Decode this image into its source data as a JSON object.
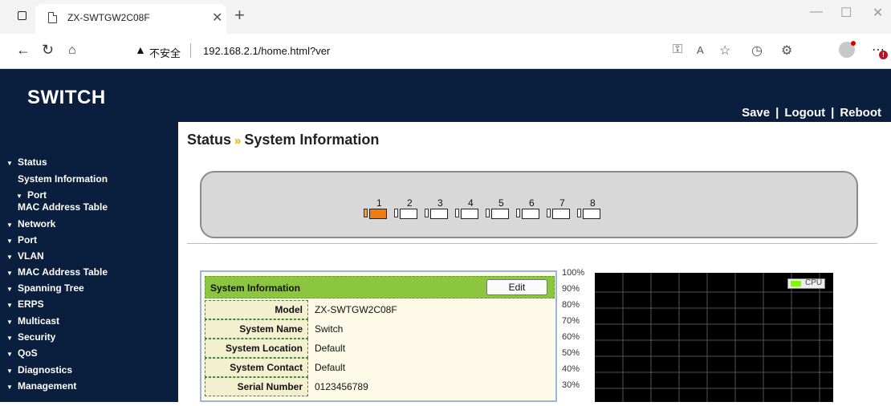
{
  "browser": {
    "tab_title": "ZX-SWTGW2C08F",
    "security_label": "不安全",
    "url": "192.168.2.1/home.html?ver",
    "more_badge": "!"
  },
  "header": {
    "logo": "SWITCH",
    "links": [
      "Save",
      "Logout",
      "Reboot"
    ]
  },
  "sidebar": {
    "items": [
      {
        "label": "Status",
        "expanded": true
      },
      {
        "label": "System Information",
        "sub": true
      },
      {
        "label": "Port",
        "sub": true,
        "expandable": true
      },
      {
        "label": "MAC Address Table",
        "sub": true
      },
      {
        "label": "Network"
      },
      {
        "label": "Port"
      },
      {
        "label": "VLAN"
      },
      {
        "label": "MAC Address Table"
      },
      {
        "label": "Spanning Tree"
      },
      {
        "label": "ERPS"
      },
      {
        "label": "Multicast"
      },
      {
        "label": "Security"
      },
      {
        "label": "QoS"
      },
      {
        "label": "Diagnostics"
      },
      {
        "label": "Management"
      }
    ]
  },
  "breadcrumb": {
    "parent": "Status",
    "separator": "»",
    "current": "System Information"
  },
  "ports": [
    {
      "num": "1",
      "active": true
    },
    {
      "num": "2",
      "active": false
    },
    {
      "num": "3",
      "active": false
    },
    {
      "num": "4",
      "active": false
    },
    {
      "num": "5",
      "active": false
    },
    {
      "num": "6",
      "active": false
    },
    {
      "num": "7",
      "active": false
    },
    {
      "num": "8",
      "active": false
    }
  ],
  "system_info": {
    "title": "System Information",
    "edit_label": "Edit",
    "rows": [
      {
        "label": "Model",
        "value": "ZX-SWTGW2C08F"
      },
      {
        "label": "System Name",
        "value": "Switch"
      },
      {
        "label": "System Location",
        "value": "Default"
      },
      {
        "label": "System Contact",
        "value": "Default"
      },
      {
        "label": "Serial Number",
        "value": "0123456789"
      }
    ]
  },
  "cpu_chart": {
    "y_ticks": [
      "100%",
      "90%",
      "80%",
      "70%",
      "60%",
      "50%",
      "40%",
      "30%"
    ],
    "legend": "CPU",
    "line_color": "#7cfc00",
    "grid_color": "#555555"
  },
  "colors": {
    "header_bg": "#0a1e3d",
    "accent_green": "#8cc63f",
    "port_active": "#f07c10",
    "crumb_arrow": "#e7b300"
  }
}
